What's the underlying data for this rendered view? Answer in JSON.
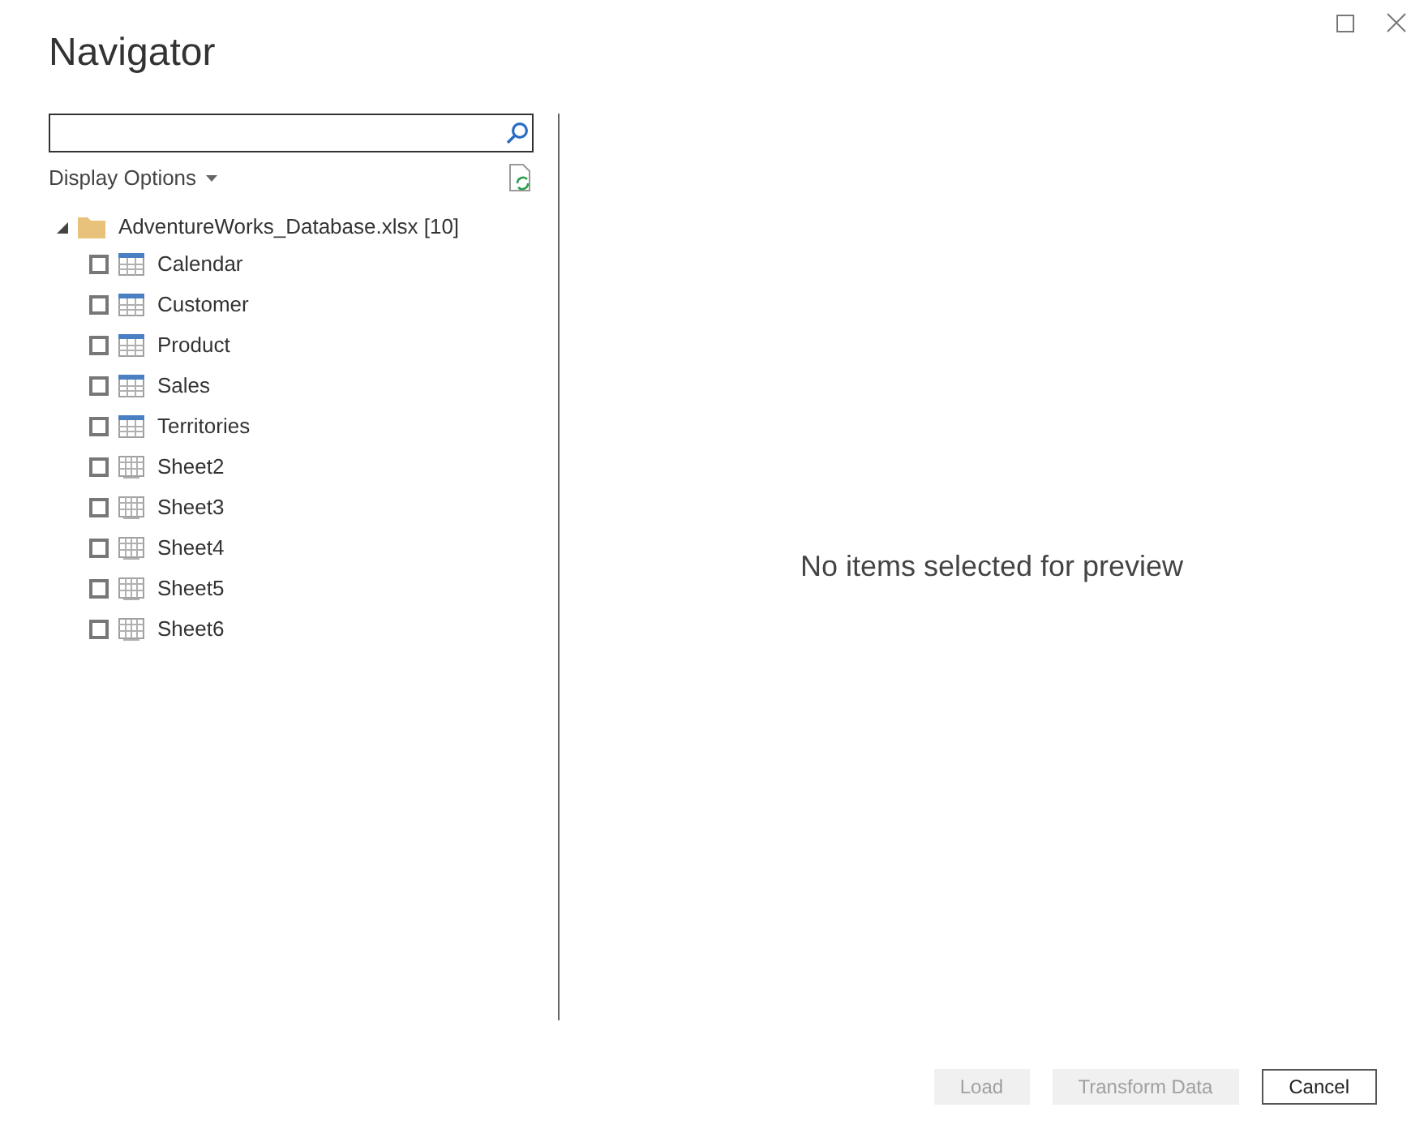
{
  "window": {
    "title": "Navigator"
  },
  "display_options": {
    "label": "Display Options"
  },
  "tree": {
    "label": "AdventureWorks_Database.xlsx [10]",
    "expanded": true,
    "children": [
      {
        "label": "Calendar",
        "kind": "table",
        "checked": false
      },
      {
        "label": "Customer",
        "kind": "table",
        "checked": false
      },
      {
        "label": "Product",
        "kind": "table",
        "checked": false
      },
      {
        "label": "Sales",
        "kind": "table",
        "checked": false
      },
      {
        "label": "Territories",
        "kind": "table",
        "checked": false
      },
      {
        "label": "Sheet2",
        "kind": "sheet",
        "checked": false
      },
      {
        "label": "Sheet3",
        "kind": "sheet",
        "checked": false
      },
      {
        "label": "Sheet4",
        "kind": "sheet",
        "checked": false
      },
      {
        "label": "Sheet5",
        "kind": "sheet",
        "checked": false
      },
      {
        "label": "Sheet6",
        "kind": "sheet",
        "checked": false
      }
    ]
  },
  "preview": {
    "message": "No items selected for preview"
  },
  "buttons": [
    {
      "label": "Load",
      "disabled": true
    },
    {
      "label": "Transform Data",
      "disabled": true
    },
    {
      "label": "Cancel",
      "disabled": false
    }
  ]
}
